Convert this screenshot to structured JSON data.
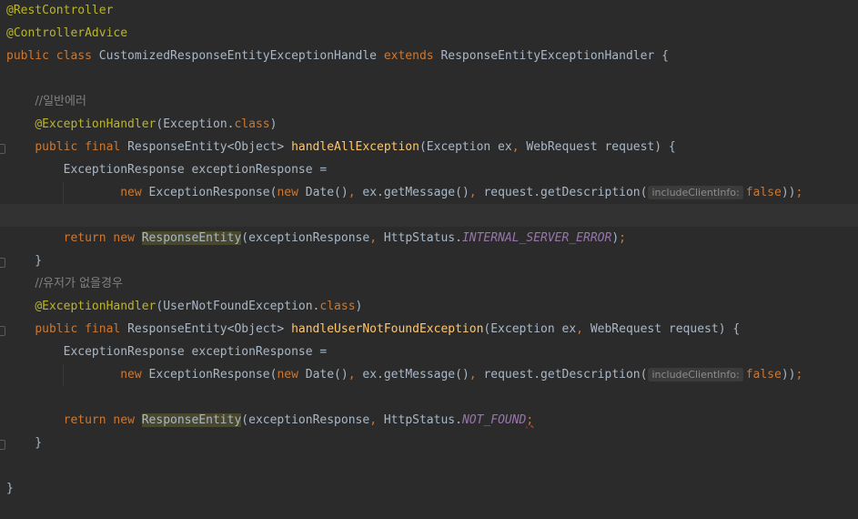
{
  "editor": {
    "current_line": 9,
    "lines": [
      [
        {
          "c": "ann",
          "t": "@RestController"
        }
      ],
      [
        {
          "c": "ann",
          "t": "@ControllerAdvice"
        }
      ],
      [
        {
          "c": "kw",
          "t": "public class "
        },
        {
          "c": "pl",
          "t": "CustomizedResponseEntityExceptionHandle "
        },
        {
          "c": "kw",
          "t": "extends "
        },
        {
          "c": "pl",
          "t": "ResponseEntityExceptionHandler {"
        }
      ],
      [],
      [
        {
          "c": "pl",
          "t": "    "
        },
        {
          "c": "cm",
          "t": "//일반에러"
        }
      ],
      [
        {
          "c": "pl",
          "t": "    "
        },
        {
          "c": "ann",
          "t": "@ExceptionHandler"
        },
        {
          "c": "pl",
          "t": "(Exception."
        },
        {
          "c": "kw",
          "t": "class"
        },
        {
          "c": "pl",
          "t": ")"
        }
      ],
      [
        {
          "c": "pl",
          "t": "    "
        },
        {
          "c": "kw",
          "t": "public final "
        },
        {
          "c": "pl",
          "t": "ResponseEntity<Object> "
        },
        {
          "c": "fn",
          "t": "handleAllException"
        },
        {
          "c": "pl",
          "t": "(Exception ex"
        },
        {
          "c": "kw",
          "t": ", "
        },
        {
          "c": "pl",
          "t": "WebRequest request) {"
        }
      ],
      [
        {
          "c": "pl",
          "t": "        ExceptionResponse exceptionResponse ="
        }
      ],
      [
        {
          "c": "pl",
          "t": "                "
        },
        {
          "c": "kw",
          "t": "new "
        },
        {
          "c": "pl",
          "t": "ExceptionResponse("
        },
        {
          "c": "kw",
          "t": "new "
        },
        {
          "c": "pl",
          "t": "Date()"
        },
        {
          "c": "kw",
          "t": ", "
        },
        {
          "c": "pl",
          "t": "ex.getMessage()"
        },
        {
          "c": "kw",
          "t": ", "
        },
        {
          "c": "pl",
          "t": "request.getDescription("
        },
        {
          "c": "hint",
          "t": "includeClientInfo:"
        },
        {
          "c": "kw",
          "t": "false"
        },
        {
          "c": "pl",
          "t": "))"
        },
        {
          "c": "kw",
          "t": ";"
        }
      ],
      [],
      [
        {
          "c": "pl",
          "t": "        "
        },
        {
          "c": "kw",
          "t": "return new "
        },
        {
          "c": "hl",
          "t": "ResponseEntity"
        },
        {
          "c": "pl",
          "t": "(exceptionResponse"
        },
        {
          "c": "kw",
          "t": ", "
        },
        {
          "c": "pl",
          "t": "HttpStatus."
        },
        {
          "c": "cnst",
          "t": "INTERNAL_SERVER_ERROR"
        },
        {
          "c": "pl",
          "t": ")"
        },
        {
          "c": "kw",
          "t": ";"
        }
      ],
      [
        {
          "c": "pl",
          "t": "    }"
        }
      ],
      [
        {
          "c": "pl",
          "t": "    "
        },
        {
          "c": "cm",
          "t": "//유저가 없을경우"
        }
      ],
      [
        {
          "c": "pl",
          "t": "    "
        },
        {
          "c": "ann",
          "t": "@ExceptionHandler"
        },
        {
          "c": "pl",
          "t": "(UserNotFoundException."
        },
        {
          "c": "kw",
          "t": "class"
        },
        {
          "c": "pl",
          "t": ")"
        }
      ],
      [
        {
          "c": "pl",
          "t": "    "
        },
        {
          "c": "kw",
          "t": "public final "
        },
        {
          "c": "pl",
          "t": "ResponseEntity<Object> "
        },
        {
          "c": "fn",
          "t": "handleUserNotFoundException"
        },
        {
          "c": "pl",
          "t": "(Exception ex"
        },
        {
          "c": "kw",
          "t": ", "
        },
        {
          "c": "pl",
          "t": "WebRequest request) {"
        }
      ],
      [
        {
          "c": "pl",
          "t": "        ExceptionResponse exceptionResponse ="
        }
      ],
      [
        {
          "c": "pl",
          "t": "                "
        },
        {
          "c": "kw",
          "t": "new "
        },
        {
          "c": "pl",
          "t": "ExceptionResponse("
        },
        {
          "c": "kw",
          "t": "new "
        },
        {
          "c": "pl",
          "t": "Date()"
        },
        {
          "c": "kw",
          "t": ", "
        },
        {
          "c": "pl",
          "t": "ex.getMessage()"
        },
        {
          "c": "kw",
          "t": ", "
        },
        {
          "c": "pl",
          "t": "request.getDescription("
        },
        {
          "c": "hint",
          "t": "includeClientInfo:"
        },
        {
          "c": "kw",
          "t": "false"
        },
        {
          "c": "pl",
          "t": "))"
        },
        {
          "c": "kw",
          "t": ";"
        }
      ],
      [],
      [
        {
          "c": "pl",
          "t": "        "
        },
        {
          "c": "kw",
          "t": "return new "
        },
        {
          "c": "hl",
          "t": "ResponseEntity"
        },
        {
          "c": "pl",
          "t": "(exceptionResponse"
        },
        {
          "c": "kw",
          "t": ", "
        },
        {
          "c": "pl",
          "t": "HttpStatus."
        },
        {
          "c": "cnst",
          "t": "NOT_FOUND"
        },
        {
          "c": "err",
          "t": ";"
        }
      ],
      [
        {
          "c": "pl",
          "t": "    }"
        }
      ],
      [],
      [
        {
          "c": "pl",
          "t": "}"
        }
      ]
    ]
  },
  "theme": {
    "background": "#2b2b2b",
    "keyword": "#cc7832",
    "annotation": "#bbb529",
    "method": "#ffc66d",
    "comment": "#808080",
    "constant": "#9876aa",
    "plain": "#a9b7c6",
    "usage_highlight": "#49482e"
  }
}
